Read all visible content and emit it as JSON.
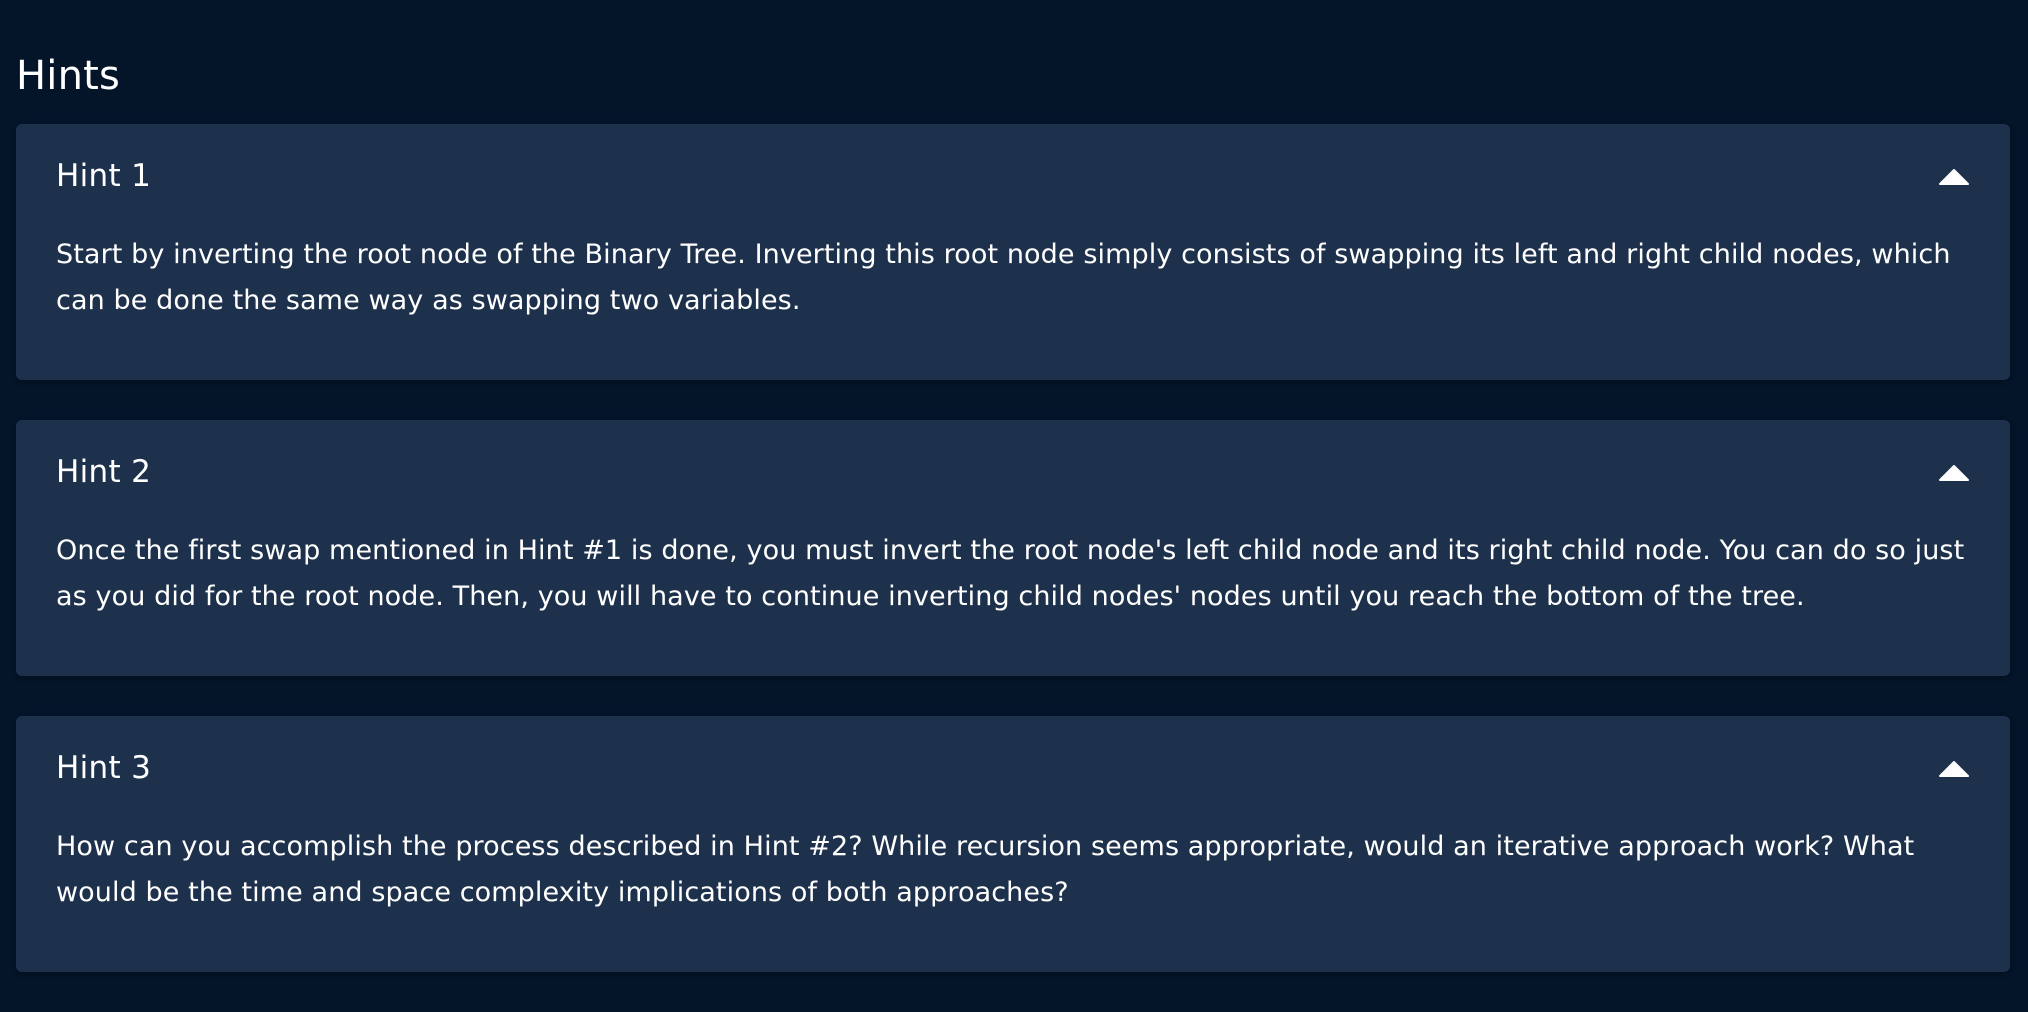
{
  "page": {
    "title": "Hints"
  },
  "hints": [
    {
      "label": "Hint 1",
      "text": "Start by inverting the root node of the Binary Tree. Inverting this root node simply consists of swapping its left and right child nodes, which can be done the same way as swapping two variables.",
      "icon": "caret-up-icon"
    },
    {
      "label": "Hint 2",
      "text": "Once the first swap mentioned in Hint #1 is done, you must invert the root node's left child node and its right child node. You can do so just as you did for the root node. Then, you will have to continue inverting child nodes' nodes until you reach the bottom of the tree.",
      "icon": "caret-up-icon"
    },
    {
      "label": "Hint 3",
      "text": "How can you accomplish the process described in Hint #2? While recursion seems appropriate, would an iterative approach work? What would be the time and space complexity implications of both approaches?",
      "icon": "caret-up-icon"
    }
  ],
  "colors": {
    "background": "#04152a",
    "card": "#1e314c",
    "text": "#ffffff"
  }
}
